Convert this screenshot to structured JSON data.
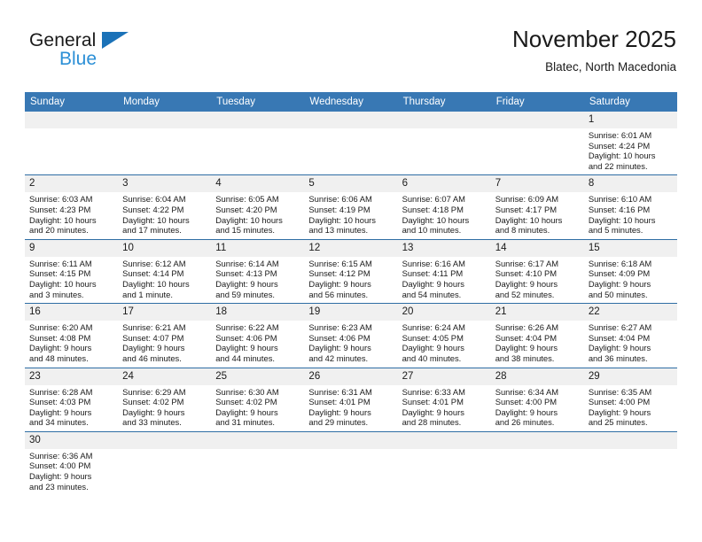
{
  "brand": {
    "name_top": "General",
    "name_bottom": "Blue",
    "flag_icon": "blue-triangle-flag-icon",
    "accent_color": "#1b72b8",
    "secondary_color": "#2b8fd6"
  },
  "header": {
    "title": "November 2025",
    "subtitle": "Blatec, North Macedonia"
  },
  "theme": {
    "header_row_bg": "#3878b4",
    "row_separator": "#2e6da4",
    "daynum_bg": "#f0f0f0",
    "text": "#1a1a1a"
  },
  "weekday_headers": [
    "Sunday",
    "Monday",
    "Tuesday",
    "Wednesday",
    "Thursday",
    "Friday",
    "Saturday"
  ],
  "labels": {
    "sunrise": "Sunrise:",
    "sunset": "Sunset:",
    "daylight": "Daylight:"
  },
  "weeks": [
    [
      {
        "day": "",
        "blank": true,
        "sunrise": "",
        "sunset": "",
        "daylight_line1": "",
        "daylight_line2": ""
      },
      {
        "day": "",
        "blank": true,
        "sunrise": "",
        "sunset": "",
        "daylight_line1": "",
        "daylight_line2": ""
      },
      {
        "day": "",
        "blank": true,
        "sunrise": "",
        "sunset": "",
        "daylight_line1": "",
        "daylight_line2": ""
      },
      {
        "day": "",
        "blank": true,
        "sunrise": "",
        "sunset": "",
        "daylight_line1": "",
        "daylight_line2": ""
      },
      {
        "day": "",
        "blank": true,
        "sunrise": "",
        "sunset": "",
        "daylight_line1": "",
        "daylight_line2": ""
      },
      {
        "day": "",
        "blank": true,
        "sunrise": "",
        "sunset": "",
        "daylight_line1": "",
        "daylight_line2": ""
      },
      {
        "day": "1",
        "blank": false,
        "sunrise": "Sunrise: 6:01 AM",
        "sunset": "Sunset: 4:24 PM",
        "daylight_line1": "Daylight: 10 hours",
        "daylight_line2": "and 22 minutes."
      }
    ],
    [
      {
        "day": "2",
        "blank": false,
        "sunrise": "Sunrise: 6:03 AM",
        "sunset": "Sunset: 4:23 PM",
        "daylight_line1": "Daylight: 10 hours",
        "daylight_line2": "and 20 minutes."
      },
      {
        "day": "3",
        "blank": false,
        "sunrise": "Sunrise: 6:04 AM",
        "sunset": "Sunset: 4:22 PM",
        "daylight_line1": "Daylight: 10 hours",
        "daylight_line2": "and 17 minutes."
      },
      {
        "day": "4",
        "blank": false,
        "sunrise": "Sunrise: 6:05 AM",
        "sunset": "Sunset: 4:20 PM",
        "daylight_line1": "Daylight: 10 hours",
        "daylight_line2": "and 15 minutes."
      },
      {
        "day": "5",
        "blank": false,
        "sunrise": "Sunrise: 6:06 AM",
        "sunset": "Sunset: 4:19 PM",
        "daylight_line1": "Daylight: 10 hours",
        "daylight_line2": "and 13 minutes."
      },
      {
        "day": "6",
        "blank": false,
        "sunrise": "Sunrise: 6:07 AM",
        "sunset": "Sunset: 4:18 PM",
        "daylight_line1": "Daylight: 10 hours",
        "daylight_line2": "and 10 minutes."
      },
      {
        "day": "7",
        "blank": false,
        "sunrise": "Sunrise: 6:09 AM",
        "sunset": "Sunset: 4:17 PM",
        "daylight_line1": "Daylight: 10 hours",
        "daylight_line2": "and 8 minutes."
      },
      {
        "day": "8",
        "blank": false,
        "sunrise": "Sunrise: 6:10 AM",
        "sunset": "Sunset: 4:16 PM",
        "daylight_line1": "Daylight: 10 hours",
        "daylight_line2": "and 5 minutes."
      }
    ],
    [
      {
        "day": "9",
        "blank": false,
        "sunrise": "Sunrise: 6:11 AM",
        "sunset": "Sunset: 4:15 PM",
        "daylight_line1": "Daylight: 10 hours",
        "daylight_line2": "and 3 minutes."
      },
      {
        "day": "10",
        "blank": false,
        "sunrise": "Sunrise: 6:12 AM",
        "sunset": "Sunset: 4:14 PM",
        "daylight_line1": "Daylight: 10 hours",
        "daylight_line2": "and 1 minute."
      },
      {
        "day": "11",
        "blank": false,
        "sunrise": "Sunrise: 6:14 AM",
        "sunset": "Sunset: 4:13 PM",
        "daylight_line1": "Daylight: 9 hours",
        "daylight_line2": "and 59 minutes."
      },
      {
        "day": "12",
        "blank": false,
        "sunrise": "Sunrise: 6:15 AM",
        "sunset": "Sunset: 4:12 PM",
        "daylight_line1": "Daylight: 9 hours",
        "daylight_line2": "and 56 minutes."
      },
      {
        "day": "13",
        "blank": false,
        "sunrise": "Sunrise: 6:16 AM",
        "sunset": "Sunset: 4:11 PM",
        "daylight_line1": "Daylight: 9 hours",
        "daylight_line2": "and 54 minutes."
      },
      {
        "day": "14",
        "blank": false,
        "sunrise": "Sunrise: 6:17 AM",
        "sunset": "Sunset: 4:10 PM",
        "daylight_line1": "Daylight: 9 hours",
        "daylight_line2": "and 52 minutes."
      },
      {
        "day": "15",
        "blank": false,
        "sunrise": "Sunrise: 6:18 AM",
        "sunset": "Sunset: 4:09 PM",
        "daylight_line1": "Daylight: 9 hours",
        "daylight_line2": "and 50 minutes."
      }
    ],
    [
      {
        "day": "16",
        "blank": false,
        "sunrise": "Sunrise: 6:20 AM",
        "sunset": "Sunset: 4:08 PM",
        "daylight_line1": "Daylight: 9 hours",
        "daylight_line2": "and 48 minutes."
      },
      {
        "day": "17",
        "blank": false,
        "sunrise": "Sunrise: 6:21 AM",
        "sunset": "Sunset: 4:07 PM",
        "daylight_line1": "Daylight: 9 hours",
        "daylight_line2": "and 46 minutes."
      },
      {
        "day": "18",
        "blank": false,
        "sunrise": "Sunrise: 6:22 AM",
        "sunset": "Sunset: 4:06 PM",
        "daylight_line1": "Daylight: 9 hours",
        "daylight_line2": "and 44 minutes."
      },
      {
        "day": "19",
        "blank": false,
        "sunrise": "Sunrise: 6:23 AM",
        "sunset": "Sunset: 4:06 PM",
        "daylight_line1": "Daylight: 9 hours",
        "daylight_line2": "and 42 minutes."
      },
      {
        "day": "20",
        "blank": false,
        "sunrise": "Sunrise: 6:24 AM",
        "sunset": "Sunset: 4:05 PM",
        "daylight_line1": "Daylight: 9 hours",
        "daylight_line2": "and 40 minutes."
      },
      {
        "day": "21",
        "blank": false,
        "sunrise": "Sunrise: 6:26 AM",
        "sunset": "Sunset: 4:04 PM",
        "daylight_line1": "Daylight: 9 hours",
        "daylight_line2": "and 38 minutes."
      },
      {
        "day": "22",
        "blank": false,
        "sunrise": "Sunrise: 6:27 AM",
        "sunset": "Sunset: 4:04 PM",
        "daylight_line1": "Daylight: 9 hours",
        "daylight_line2": "and 36 minutes."
      }
    ],
    [
      {
        "day": "23",
        "blank": false,
        "sunrise": "Sunrise: 6:28 AM",
        "sunset": "Sunset: 4:03 PM",
        "daylight_line1": "Daylight: 9 hours",
        "daylight_line2": "and 34 minutes."
      },
      {
        "day": "24",
        "blank": false,
        "sunrise": "Sunrise: 6:29 AM",
        "sunset": "Sunset: 4:02 PM",
        "daylight_line1": "Daylight: 9 hours",
        "daylight_line2": "and 33 minutes."
      },
      {
        "day": "25",
        "blank": false,
        "sunrise": "Sunrise: 6:30 AM",
        "sunset": "Sunset: 4:02 PM",
        "daylight_line1": "Daylight: 9 hours",
        "daylight_line2": "and 31 minutes."
      },
      {
        "day": "26",
        "blank": false,
        "sunrise": "Sunrise: 6:31 AM",
        "sunset": "Sunset: 4:01 PM",
        "daylight_line1": "Daylight: 9 hours",
        "daylight_line2": "and 29 minutes."
      },
      {
        "day": "27",
        "blank": false,
        "sunrise": "Sunrise: 6:33 AM",
        "sunset": "Sunset: 4:01 PM",
        "daylight_line1": "Daylight: 9 hours",
        "daylight_line2": "and 28 minutes."
      },
      {
        "day": "28",
        "blank": false,
        "sunrise": "Sunrise: 6:34 AM",
        "sunset": "Sunset: 4:00 PM",
        "daylight_line1": "Daylight: 9 hours",
        "daylight_line2": "and 26 minutes."
      },
      {
        "day": "29",
        "blank": false,
        "sunrise": "Sunrise: 6:35 AM",
        "sunset": "Sunset: 4:00 PM",
        "daylight_line1": "Daylight: 9 hours",
        "daylight_line2": "and 25 minutes."
      }
    ],
    [
      {
        "day": "30",
        "blank": false,
        "sunrise": "Sunrise: 6:36 AM",
        "sunset": "Sunset: 4:00 PM",
        "daylight_line1": "Daylight: 9 hours",
        "daylight_line2": "and 23 minutes."
      },
      {
        "day": "",
        "blank": true,
        "sunrise": "",
        "sunset": "",
        "daylight_line1": "",
        "daylight_line2": ""
      },
      {
        "day": "",
        "blank": true,
        "sunrise": "",
        "sunset": "",
        "daylight_line1": "",
        "daylight_line2": ""
      },
      {
        "day": "",
        "blank": true,
        "sunrise": "",
        "sunset": "",
        "daylight_line1": "",
        "daylight_line2": ""
      },
      {
        "day": "",
        "blank": true,
        "sunrise": "",
        "sunset": "",
        "daylight_line1": "",
        "daylight_line2": ""
      },
      {
        "day": "",
        "blank": true,
        "sunrise": "",
        "sunset": "",
        "daylight_line1": "",
        "daylight_line2": ""
      },
      {
        "day": "",
        "blank": true,
        "sunrise": "",
        "sunset": "",
        "daylight_line1": "",
        "daylight_line2": ""
      }
    ]
  ]
}
